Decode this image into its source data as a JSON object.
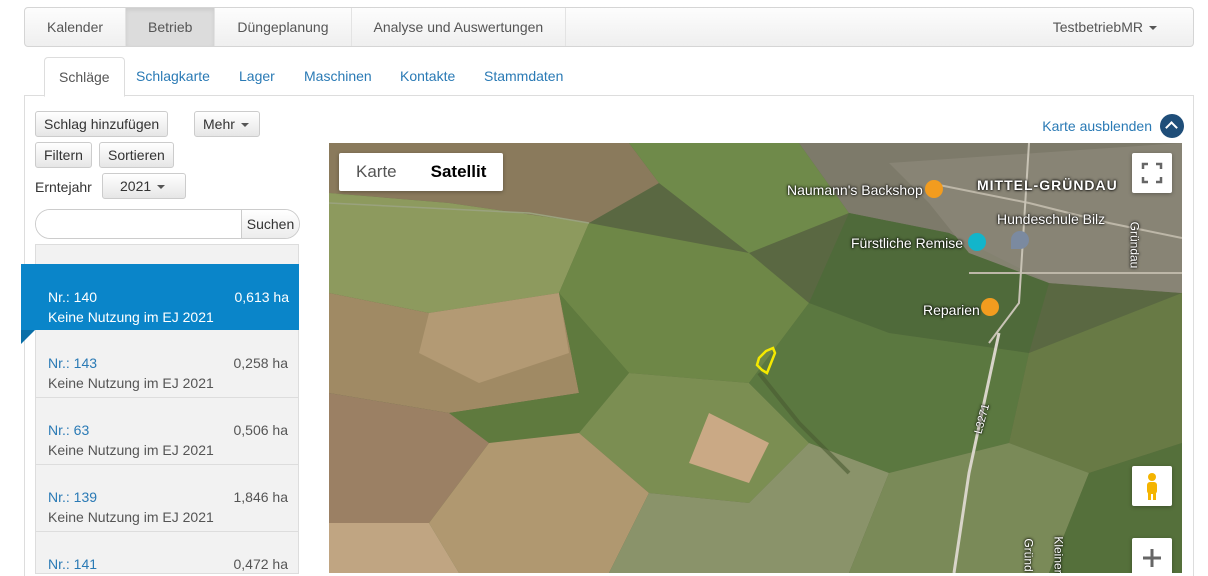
{
  "topnav": {
    "items": [
      "Kalender",
      "Betrieb",
      "Düngeplanung",
      "Analyse und Auswertungen"
    ],
    "user": "TestbetriebMR"
  },
  "tabs": [
    "Schläge",
    "Schlagkarte",
    "Lager",
    "Maschinen",
    "Kontakte",
    "Stammdaten"
  ],
  "toolbar": {
    "add_label": "Schlag hinzufügen",
    "more_label": "Mehr",
    "filter_label": "Filtern",
    "sort_label": "Sortieren",
    "year_label": "Erntejahr",
    "year_value": "2021"
  },
  "search": {
    "value": "",
    "placeholder": "",
    "button_label": "Suchen"
  },
  "fields": [
    {
      "nr": "Nr.: 140",
      "area": "0,613 ha",
      "use": "Keine Nutzung im EJ 2021",
      "selected": true
    },
    {
      "nr": "Nr.: 143",
      "area": "0,258 ha",
      "use": "Keine Nutzung im EJ 2021"
    },
    {
      "nr": "Nr.: 63",
      "area": "0,506 ha",
      "use": "Keine Nutzung im EJ 2021"
    },
    {
      "nr": "Nr.: 139",
      "area": "1,846 ha",
      "use": "Keine Nutzung im EJ 2021"
    },
    {
      "nr": "Nr.: 141",
      "area": "0,472 ha",
      "use": ""
    }
  ],
  "map": {
    "hide_label": "Karte ausblenden",
    "type_karte": "Karte",
    "type_satellit": "Satellit",
    "pois": {
      "town": "MITTEL-GRÜNDAU",
      "bakery": "Naumann's Backshop",
      "dog_school": "Hundeschule Bilz",
      "remise": "Fürstliche Remise",
      "reparien": "Reparien",
      "road": "L3271",
      "grundau_river": "Gründau",
      "grundau_bottom": "Gründ",
      "kleiner": "Kleiner"
    },
    "colors": {
      "field_outline": "#f5e900",
      "accent": "#0a85c9"
    }
  }
}
